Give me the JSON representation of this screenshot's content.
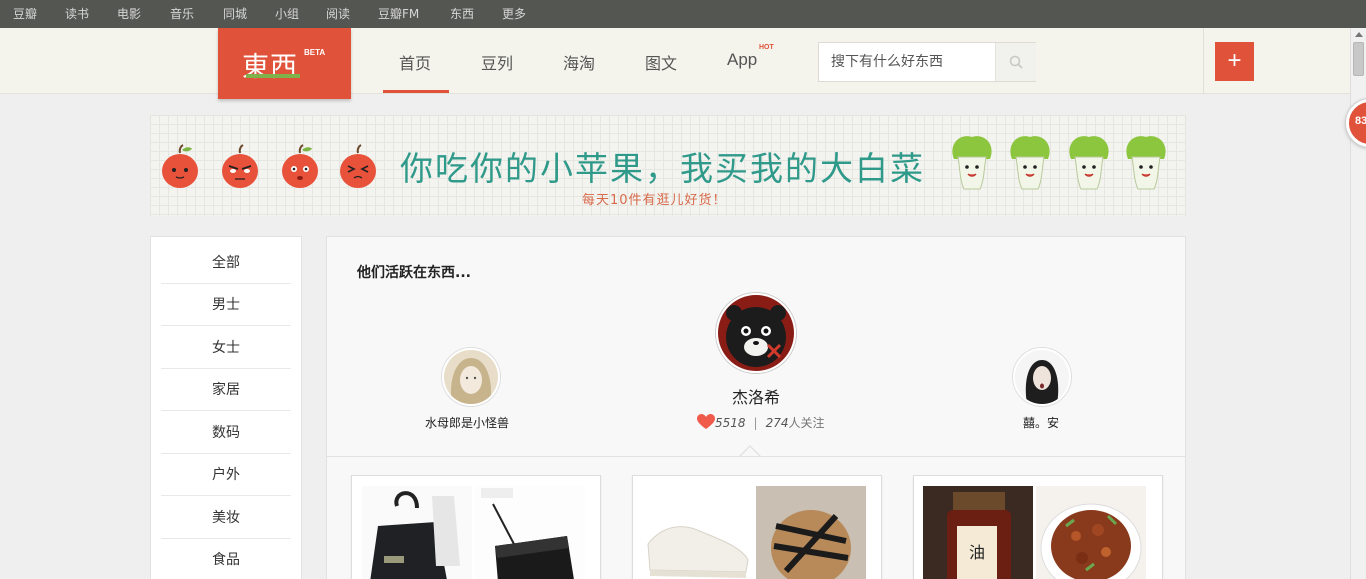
{
  "global_nav": {
    "items": [
      "豆瓣",
      "读书",
      "电影",
      "音乐",
      "同城",
      "小组",
      "阅读",
      "豆瓣FM",
      "东西",
      "更多"
    ]
  },
  "header": {
    "logo_text": "東西",
    "logo_badge": "BETA",
    "tabs": [
      "首页",
      "豆列",
      "海淘",
      "图文",
      "App"
    ],
    "active_tab": "首页",
    "app_badge": "HOT",
    "search_placeholder": "搜下有什么好东西",
    "add_button": "+"
  },
  "floating_badge": "83",
  "banner": {
    "title": "你吃你的小苹果，我买我的大白菜",
    "subtitle": "每天10件有逛儿好货！"
  },
  "sidebar": {
    "categories": [
      "全部",
      "男士",
      "女士",
      "家居",
      "数码",
      "户外",
      "美妆",
      "食品"
    ]
  },
  "active_users": {
    "title": "他们活跃在东西...",
    "left_user": "水母郎是小怪兽",
    "featured_user": {
      "name": "杰洛希",
      "likes": "5518",
      "follow_count": "274",
      "follow_unit": "人关注",
      "separator": "|"
    },
    "right_user": "囍。安"
  },
  "colors": {
    "brand": "#e0523a",
    "nav_bg": "#545652",
    "header_bg": "#f4f4ec"
  }
}
